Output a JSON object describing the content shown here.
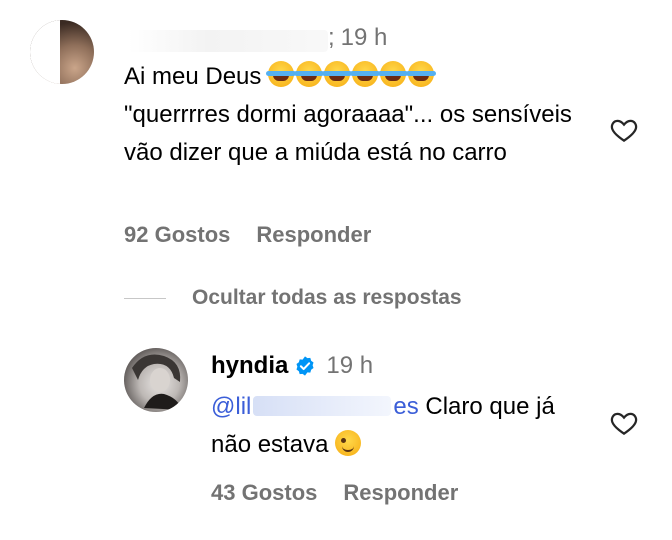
{
  "comment": {
    "time": "19 h",
    "time_prefix": ";",
    "text_line1": "Ai meu Deus",
    "emojis": [
      "😂",
      "😂",
      "😂",
      "😂",
      "😂",
      "😂"
    ],
    "text_rest": "\"querrrres dormi agoraaaa\"... os sensíveis vão dizer que a miúda está no carro",
    "likes": "92 Gostos",
    "reply_label": "Responder",
    "like_icon": "heart-icon"
  },
  "hide_replies_label": "Ocultar todas as respostas",
  "reply": {
    "username": "hyndia",
    "verified_icon": "verified-badge-icon",
    "time": "19 h",
    "mention_start": "@lil",
    "mention_end": "es",
    "text": "Claro que já não estava",
    "emoji": "😉",
    "likes": "43 Gostos",
    "reply_label": "Responder",
    "like_icon": "heart-icon"
  },
  "colors": {
    "secondary_text": "#737373",
    "mention": "#3b5ed8",
    "verified": "#0095f6"
  }
}
